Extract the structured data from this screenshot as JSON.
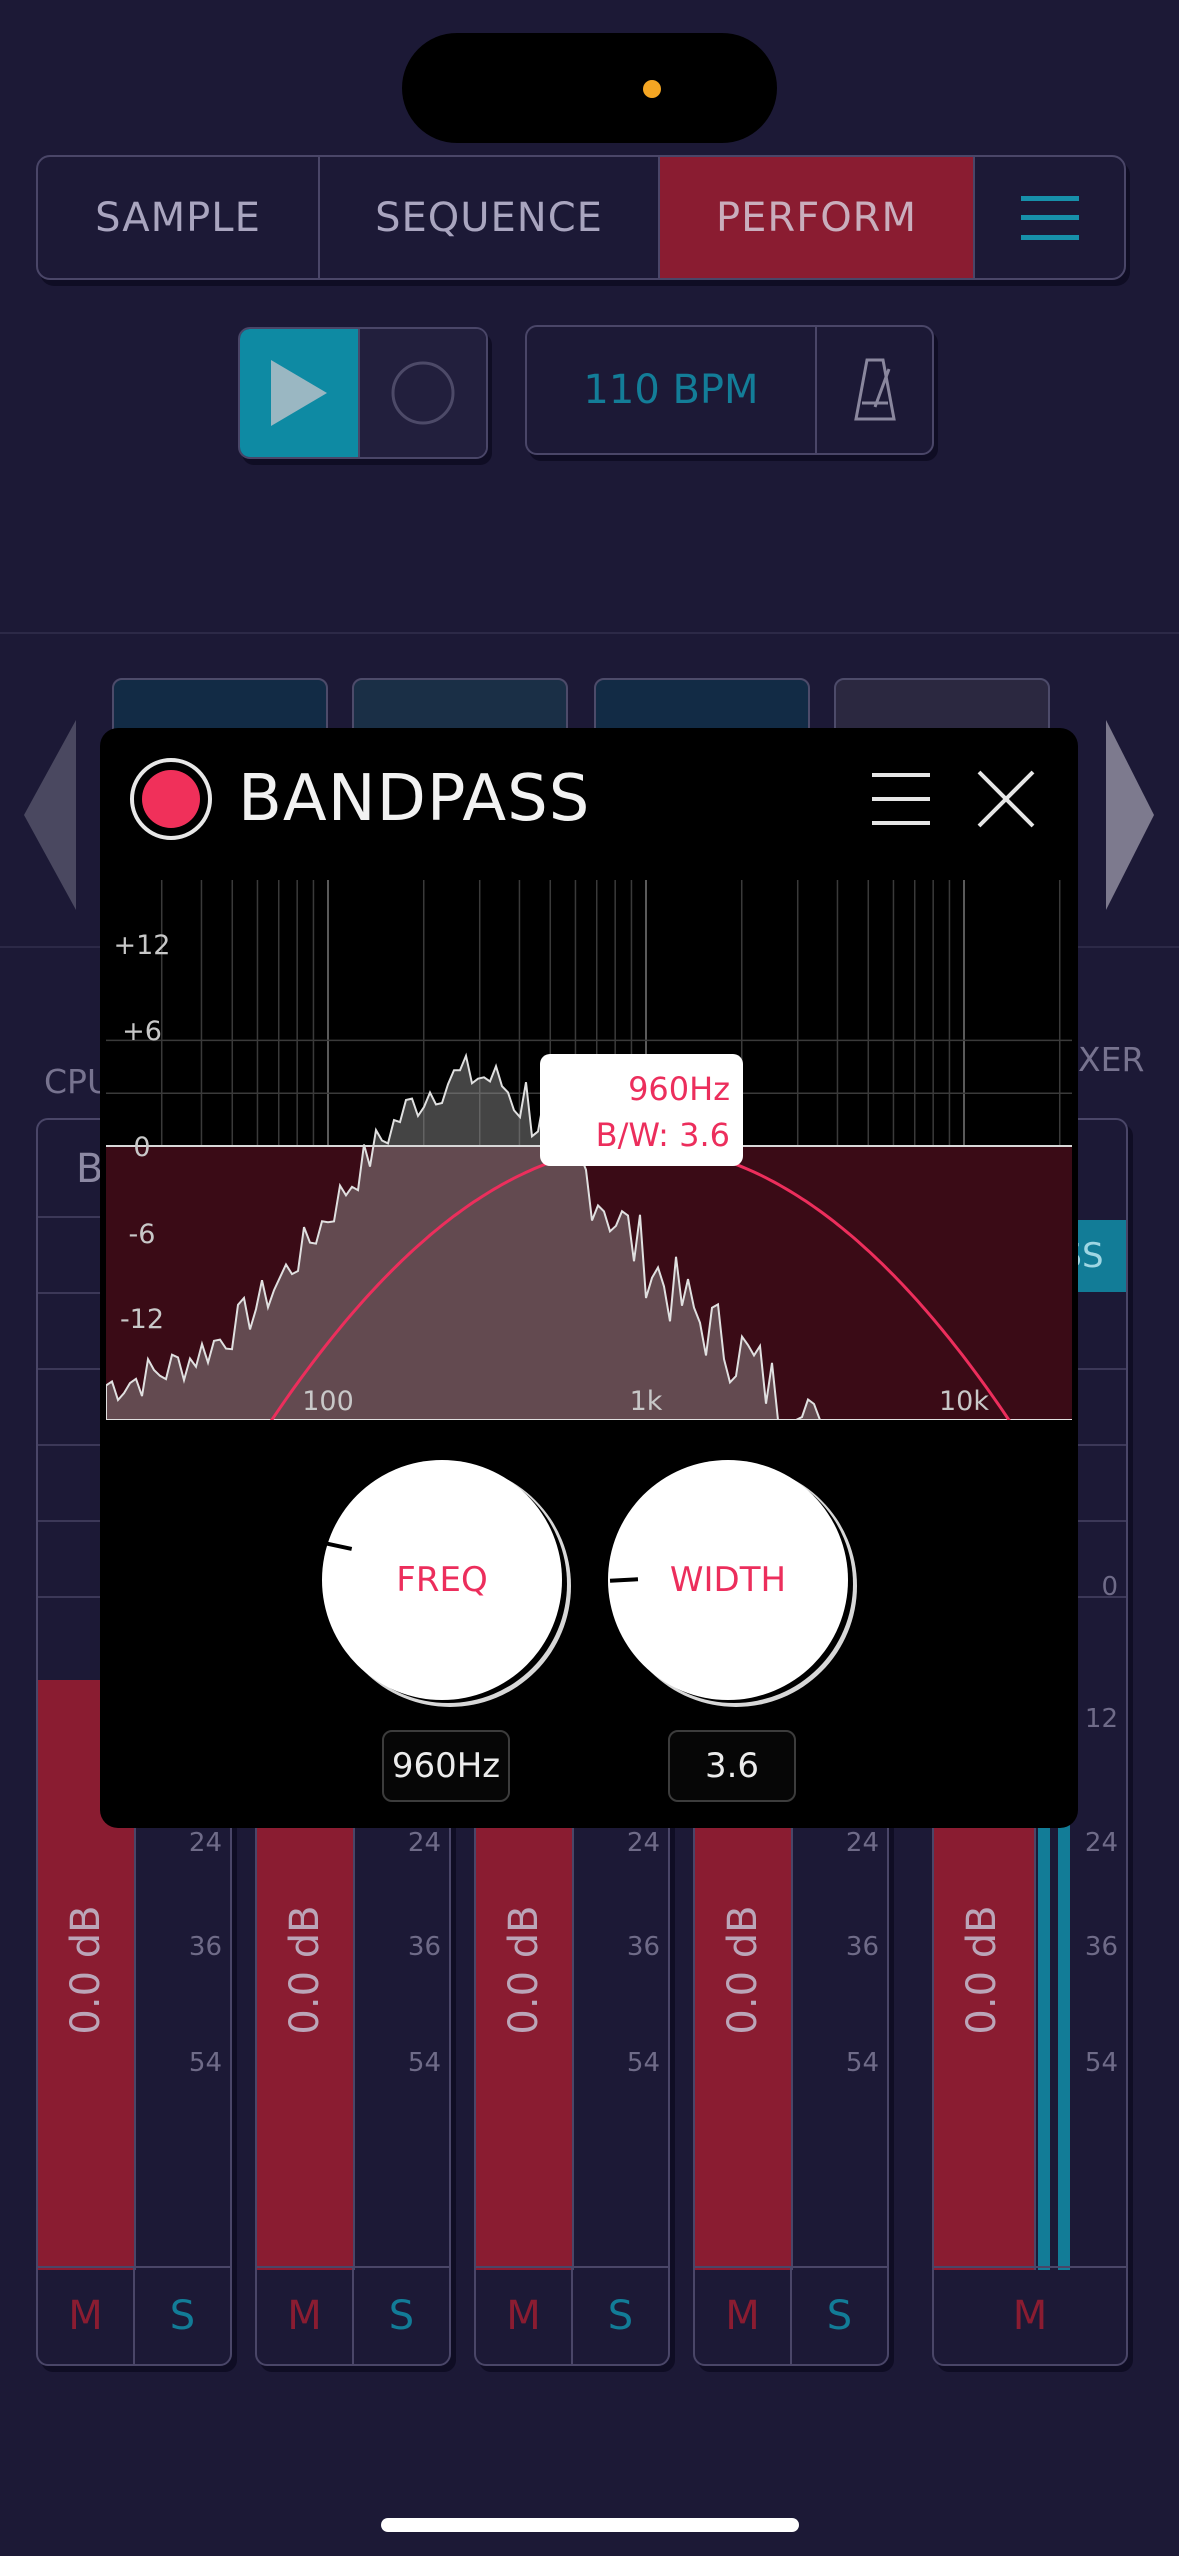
{
  "tabs": [
    {
      "label": "SAMPLE",
      "active": false
    },
    {
      "label": "SEQUENCE",
      "active": false
    },
    {
      "label": "PERFORM",
      "active": true
    }
  ],
  "transport": {
    "bpm_label": "110 BPM"
  },
  "side_labels": {
    "left": "CPU",
    "left_b": "B",
    "right": "XER",
    "right_ss": "SS"
  },
  "modal": {
    "title": "BANDPASS",
    "graph": {
      "y_ticks": [
        "+12",
        "+6",
        "0",
        "-6",
        "-12"
      ],
      "x_ticks": [
        "100",
        "1k",
        "10k"
      ],
      "tooltip_freq": "960Hz",
      "tooltip_bw": "B/W: 3.6"
    },
    "knobs": [
      {
        "label": "FREQ",
        "value": "960Hz"
      },
      {
        "label": "WIDTH",
        "value": "3.6"
      }
    ]
  },
  "mixer": {
    "channels": [
      {
        "level": "0.0 dB",
        "mute": "M",
        "solo": "S"
      },
      {
        "level": "0.0 dB",
        "mute": "M",
        "solo": "S"
      },
      {
        "level": "0.0 dB",
        "mute": "M",
        "solo": "S"
      },
      {
        "level": "0.0 dB",
        "mute": "M",
        "solo": "S"
      },
      {
        "level": "0.0 dB",
        "mute": "M"
      }
    ],
    "scale": [
      "12",
      "24",
      "36",
      "54"
    ],
    "master_extra": [
      "0",
      "12",
      "24",
      "36",
      "54"
    ]
  },
  "colors": {
    "background": "#1c1936",
    "accent_red": "#8a1c31",
    "accent_teal": "#0e8aa3",
    "curve_pink": "#ec2e5c"
  }
}
